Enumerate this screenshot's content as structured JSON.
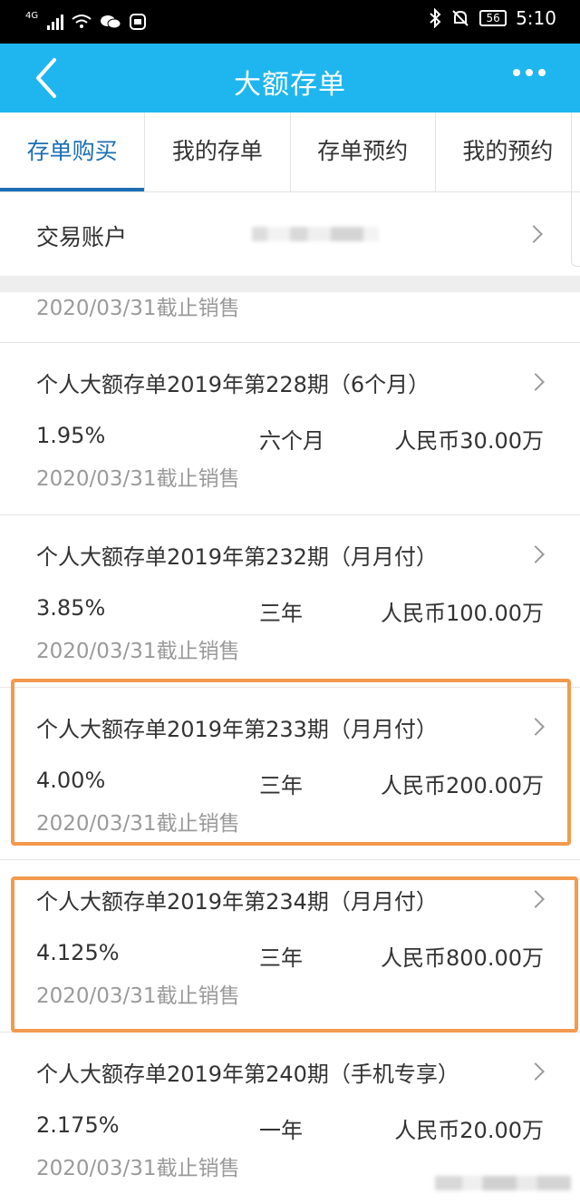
{
  "status_bar": {
    "network": "4G",
    "battery": "56",
    "time": "5:10",
    "icons": [
      "signal-icon",
      "wifi-icon",
      "wechat-icon",
      "app-notification-icon",
      "bluetooth-icon",
      "mute-icon",
      "battery-icon"
    ]
  },
  "header": {
    "title": "大额存单",
    "back_icon": "back-arrow-icon",
    "more_icon": "more-dots-icon",
    "background": "#1fb6ef"
  },
  "tabs": [
    {
      "label": "存单购买",
      "active": true
    },
    {
      "label": "我的存单",
      "active": false
    },
    {
      "label": "存单预约",
      "active": false
    },
    {
      "label": "我的预约",
      "active": false
    }
  ],
  "account": {
    "label": "交易账户"
  },
  "partial_item": {
    "date": "2020/03/31截止销售"
  },
  "products": [
    {
      "name": "个人大额存单2019年第228期（6个月）",
      "rate": "1.95%",
      "term": "六个月",
      "amount": "人民币30.00万",
      "date": "2020/03/31截止销售",
      "highlighted": false
    },
    {
      "name": "个人大额存单2019年第232期（月月付）",
      "rate": "3.85%",
      "term": "三年",
      "amount": "人民币100.00万",
      "date": "2020/03/31截止销售",
      "highlighted": false
    },
    {
      "name": "个人大额存单2019年第233期（月月付）",
      "rate": "4.00%",
      "term": "三年",
      "amount": "人民币200.00万",
      "date": "2020/03/31截止销售",
      "highlighted": true
    },
    {
      "name": "个人大额存单2019年第234期（月月付）",
      "rate": "4.125%",
      "term": "三年",
      "amount": "人民币800.00万",
      "date": "2020/03/31截止销售",
      "highlighted": true
    },
    {
      "name": "个人大额存单2019年第240期（手机专享）",
      "rate": "2.175%",
      "term": "一年",
      "amount": "人民币20.00万",
      "date": "2020/03/31截止销售",
      "highlighted": false
    }
  ],
  "colors": {
    "accent": "#1b6fb5",
    "highlight_border": "#f29a4e",
    "secondary_text": "#9a9a9a"
  }
}
